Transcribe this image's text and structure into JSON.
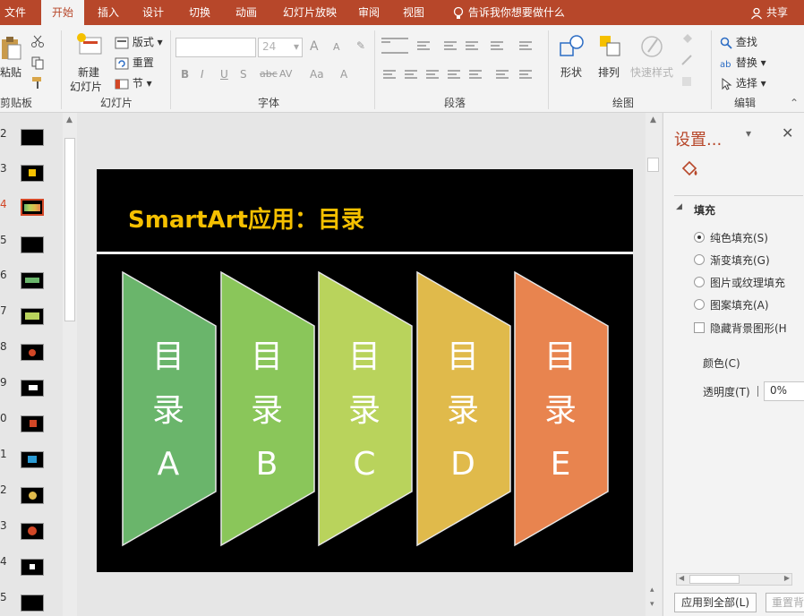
{
  "tabs": [
    "文件",
    "开始",
    "插入",
    "设计",
    "切换",
    "动画",
    "幻灯片放映",
    "审阅",
    "视图"
  ],
  "active_tab": "开始",
  "tell_me": "告诉我你想要做什么",
  "share": "共享",
  "ribbon": {
    "clipboard": {
      "paste": "粘贴",
      "label": "剪贴板"
    },
    "slides": {
      "new_slide_1": "新建",
      "new_slide_2": "幻灯片",
      "layout": "版式",
      "reset": "重置",
      "section": "节",
      "label": "幻灯片"
    },
    "font": {
      "size": "24",
      "label": "字体",
      "bold": "B",
      "italic": "I",
      "underline": "U",
      "shadow": "S",
      "strike": "abc",
      "spacing": "AV",
      "case": "Aa",
      "color": "A",
      "grow": "A",
      "shrink": "A"
    },
    "paragraph": {
      "label": "段落"
    },
    "drawing": {
      "shapes": "形状",
      "arrange": "排列",
      "quick_styles": "快速样式",
      "label": "绘图"
    },
    "editing": {
      "find": "查找",
      "replace": "替换",
      "select": "选择",
      "label": "编辑"
    }
  },
  "thumbnails": {
    "numbers": [
      "2",
      "3",
      "4",
      "5",
      "6",
      "7",
      "8",
      "9",
      "0",
      "1",
      "2",
      "3",
      "4",
      "5"
    ],
    "active_index": 2
  },
  "slide": {
    "title": "SmartArt应用：目录",
    "chevrons": [
      {
        "line1": "目",
        "line2": "录",
        "line3": "A",
        "color": "#6ab56b"
      },
      {
        "line1": "目",
        "line2": "录",
        "line3": "B",
        "color": "#8ac65a"
      },
      {
        "line1": "目",
        "line2": "录",
        "line3": "C",
        "color": "#b9d35c"
      },
      {
        "line1": "目",
        "line2": "录",
        "line3": "D",
        "color": "#e0ba4b"
      },
      {
        "line1": "目",
        "line2": "录",
        "line3": "E",
        "color": "#e8844f"
      }
    ]
  },
  "pane": {
    "title": "设置...",
    "section": "填充",
    "options": [
      "纯色填充(S)",
      "渐变填充(G)",
      "图片或纹理填充",
      "图案填充(A)"
    ],
    "selected_option": "纯色填充(S)",
    "hide_bg": "隐藏背景图形(H",
    "color_label": "颜色(C)",
    "transparency_label": "透明度(T)",
    "transparency_value": "0%",
    "apply_all": "应用到全部(L)",
    "reset_bg": "重置背"
  },
  "colors": {
    "accent": "#b7472a",
    "title": "#f5c000"
  }
}
